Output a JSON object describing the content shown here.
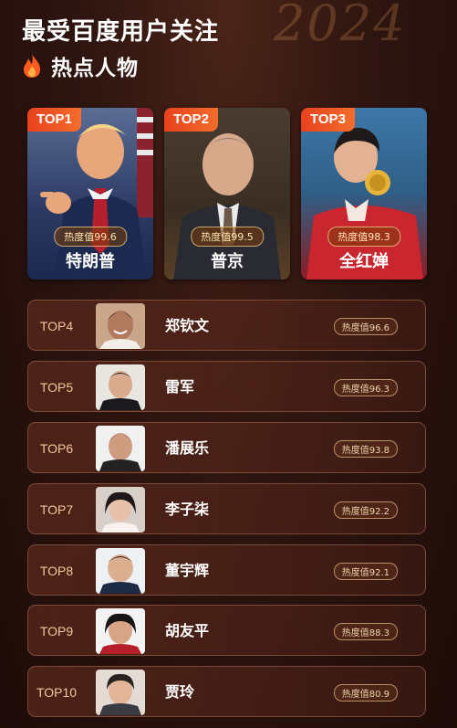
{
  "header": {
    "title": "最受百度用户关注",
    "subtitle": "热点人物",
    "icon": "flame-icon",
    "accent": "#e8411d"
  },
  "top3": [
    {
      "rank": "TOP1",
      "name": "特朗普",
      "heat": "热度值99.6"
    },
    {
      "rank": "TOP2",
      "name": "普京",
      "heat": "热度值99.5"
    },
    {
      "rank": "TOP3",
      "name": "全红婵",
      "heat": "热度值98.3"
    }
  ],
  "list": [
    {
      "rank": "TOP4",
      "name": "郑钦文",
      "heat": "热度值96.6"
    },
    {
      "rank": "TOP5",
      "name": "雷军",
      "heat": "热度值96.3"
    },
    {
      "rank": "TOP6",
      "name": "潘展乐",
      "heat": "热度值93.8"
    },
    {
      "rank": "TOP7",
      "name": "李子柒",
      "heat": "热度值92.2"
    },
    {
      "rank": "TOP8",
      "name": "董宇辉",
      "heat": "热度值92.1"
    },
    {
      "rank": "TOP9",
      "name": "胡友平",
      "heat": "热度值88.3"
    },
    {
      "rank": "TOP10",
      "name": "贾玲",
      "heat": "热度值80.9"
    }
  ]
}
